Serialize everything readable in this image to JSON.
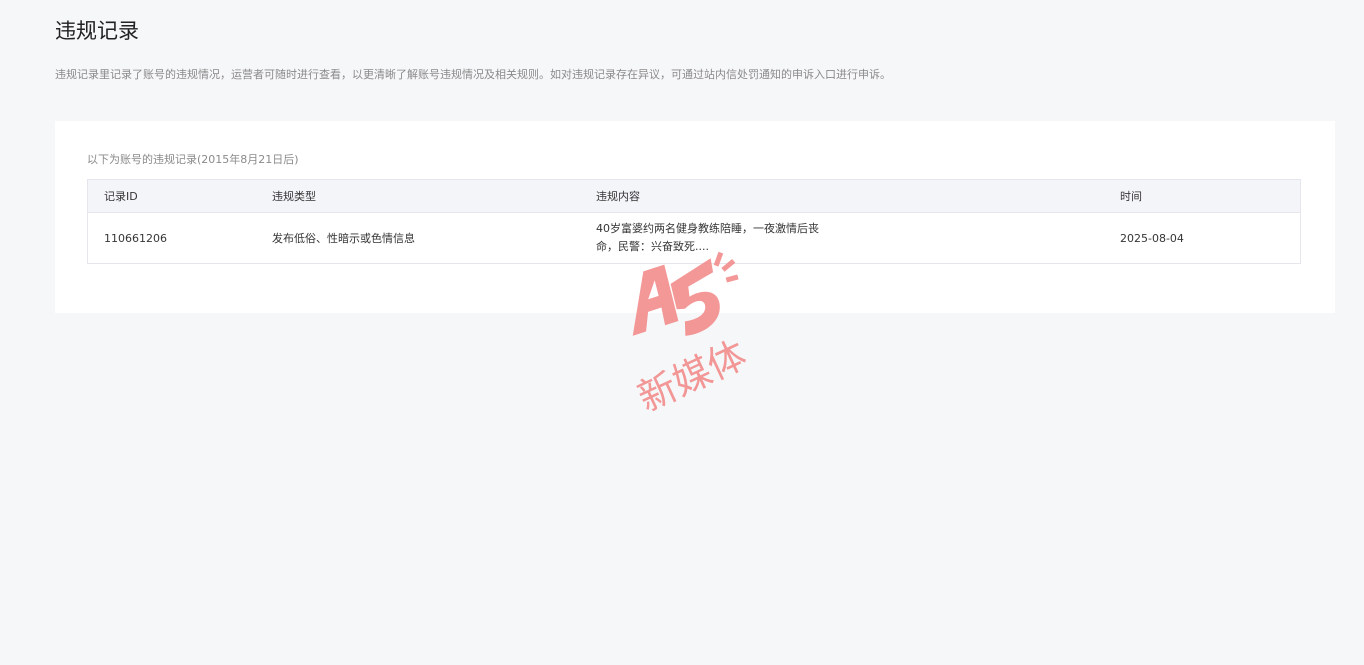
{
  "page": {
    "title": "违规记录",
    "description": "违规记录里记录了账号的违规情况，运营者可随时进行查看，以更清晰了解账号违规情况及相关规则。如对违规记录存在异议，可通过站内信处罚通知的申诉入口进行申诉。"
  },
  "records": {
    "caption": "以下为账号的违规记录(2015年8月21日后)",
    "columns": [
      "记录ID",
      "违规类型",
      "违规内容",
      "时间"
    ],
    "rows": [
      {
        "id": "110661206",
        "type": "发布低俗、性暗示或色情信息",
        "content": "40岁富婆约两名健身教练陪睡，一夜激情后丧命，民警：兴奋致死....",
        "time": "2025-08-04"
      }
    ]
  },
  "watermark": {
    "logo_text": "A5",
    "label": "新媒体",
    "color": "#f25a5a"
  }
}
